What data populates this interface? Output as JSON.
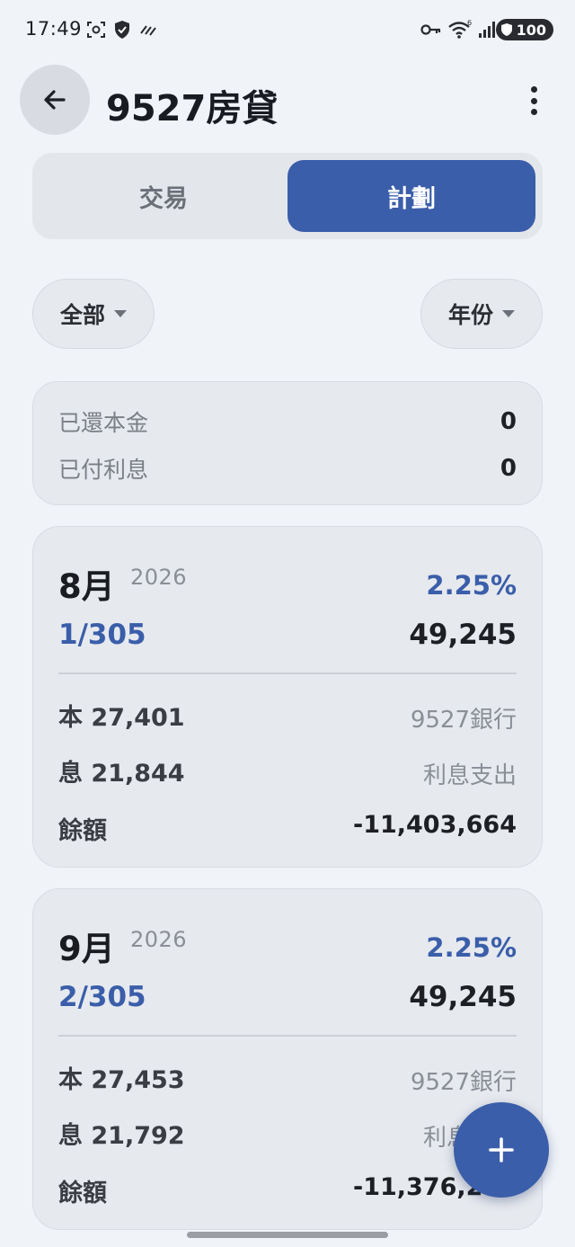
{
  "status_bar": {
    "time": "17:49",
    "battery": "100"
  },
  "header": {
    "title": "9527房貸"
  },
  "tabs": [
    {
      "label": "交易",
      "active": false
    },
    {
      "label": "計劃",
      "active": true
    }
  ],
  "filters": {
    "left_chip": "全部",
    "right_chip": "年份"
  },
  "summary": {
    "repaid_principal_label": "已還本金",
    "repaid_principal_value": "0",
    "paid_interest_label": "已付利息",
    "paid_interest_value": "0"
  },
  "plans": [
    {
      "month": "8月",
      "year": "2026",
      "rate": "2.25%",
      "period": "1/305",
      "amount": "49,245",
      "principal": "本 27,401",
      "bank": "9527銀行",
      "interest": "息 21,844",
      "category": "利息支出",
      "balance_label": "餘額",
      "balance": "-11,403,664"
    },
    {
      "month": "9月",
      "year": "2026",
      "rate": "2.25%",
      "period": "2/305",
      "amount": "49,245",
      "principal": "本 27,453",
      "bank": "9527銀行",
      "interest": "息 21,792",
      "category": "利息支出",
      "balance_label": "餘額",
      "balance": "-11,376,211"
    }
  ],
  "colors": {
    "accent": "#3a5ea9",
    "background": "#f0f3f8",
    "card": "#e6e9ee"
  },
  "icons": {
    "back": "arrow-left-icon",
    "more": "more-vert-icon",
    "fab": "plus-icon"
  }
}
